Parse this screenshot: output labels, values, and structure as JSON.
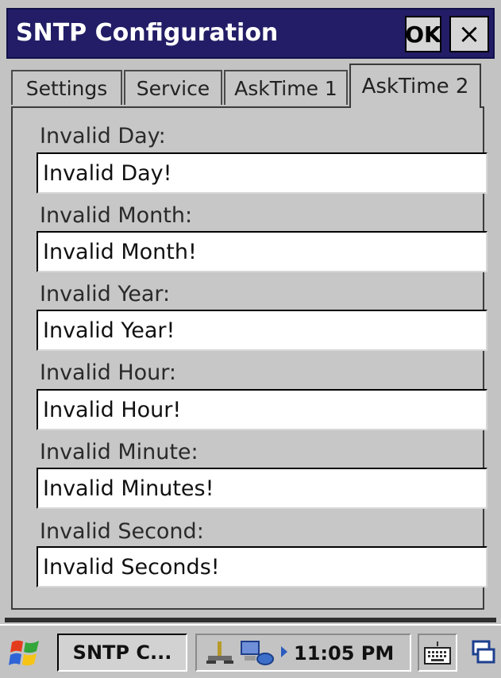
{
  "window": {
    "title": "SNTP Configuration",
    "ok_label": "OK",
    "close_label": "×"
  },
  "tabs": [
    {
      "label": "Settings",
      "active": false
    },
    {
      "label": "Service",
      "active": false
    },
    {
      "label": "AskTime 1",
      "active": false
    },
    {
      "label": "AskTime 2",
      "active": true
    }
  ],
  "fields": [
    {
      "label": "Invalid Day:",
      "value": "Invalid Day!"
    },
    {
      "label": "Invalid Month:",
      "value": "Invalid Month!"
    },
    {
      "label": "Invalid Year:",
      "value": "Invalid Year!"
    },
    {
      "label": "Invalid Hour:",
      "value": "Invalid Hour!"
    },
    {
      "label": "Invalid Minute:",
      "value": "Invalid Minutes!"
    },
    {
      "label": "Invalid Second:",
      "value": "Invalid Seconds!"
    }
  ],
  "taskbar": {
    "task_label": "SNTP C...",
    "time": "11:05 PM"
  },
  "icons": {
    "start": "windows-flag-icon",
    "tray": [
      "network-icon",
      "connection-icon",
      "tray-arrow-icon"
    ],
    "keyboard": "keyboard-icon",
    "switch": "window-switch-icon"
  },
  "colors": {
    "titlebar": "#221d66",
    "window_bg": "#c3c3c3",
    "input_bg": "#ffffff"
  }
}
